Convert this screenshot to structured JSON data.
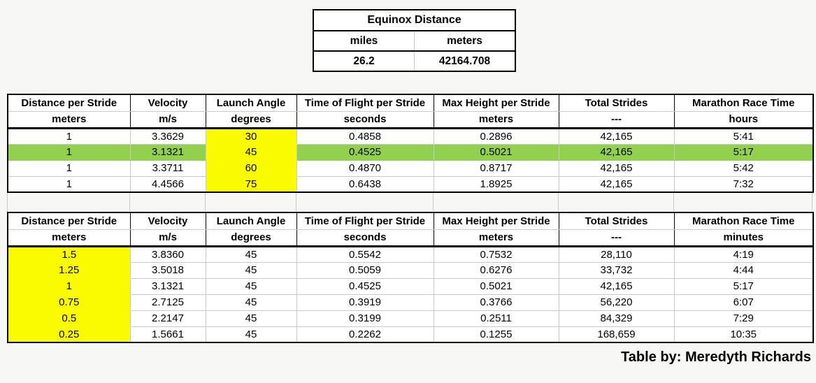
{
  "colors": {
    "page_bg": "#F7F7F6",
    "highlight_yellow": "#FBFB00",
    "highlight_green": "#92D050",
    "grid_line": "#C9C9C9",
    "border_black": "#000000"
  },
  "equinox": {
    "title": "Equinox Distance",
    "columns": [
      "miles",
      "meters"
    ],
    "values": [
      "26.2",
      "42164.708"
    ]
  },
  "table1": {
    "header_names": [
      "Distance per Stride",
      "Velocity",
      "Launch Angle",
      "Time of Flight per Stride",
      "Max Height per Stride",
      "Total Strides",
      "Marathon Race Time"
    ],
    "header_units": [
      "meters",
      "m/s",
      "degrees",
      "seconds",
      "meters",
      "---",
      "hours"
    ],
    "rows": [
      [
        "1",
        "3.3629",
        "30",
        "0.4858",
        "0.2896",
        "42,165",
        "5:41"
      ],
      [
        "1",
        "3.1321",
        "45",
        "0.4525",
        "0.5021",
        "42,165",
        "5:17"
      ],
      [
        "1",
        "3.3711",
        "60",
        "0.4870",
        "0.8717",
        "42,165",
        "5:42"
      ],
      [
        "1",
        "4.4566",
        "75",
        "0.6438",
        "1.8925",
        "42,165",
        "7:32"
      ]
    ]
  },
  "table2": {
    "header_names": [
      "Distance per Stride",
      "Velocity",
      "Launch Angle",
      "Time of Flight per Stride",
      "Max Height per Stride",
      "Total Strides",
      "Marathon Race Time"
    ],
    "header_units": [
      "meters",
      "m/s",
      "degrees",
      "seconds",
      "meters",
      "---",
      "minutes"
    ],
    "rows": [
      [
        "1.5",
        "3.8360",
        "45",
        "0.5542",
        "0.7532",
        "28,110",
        "4:19"
      ],
      [
        "1.25",
        "3.5018",
        "45",
        "0.5059",
        "0.6276",
        "33,732",
        "4:44"
      ],
      [
        "1",
        "3.1321",
        "45",
        "0.4525",
        "0.5021",
        "42,165",
        "5:17"
      ],
      [
        "0.75",
        "2.7125",
        "45",
        "0.3919",
        "0.3766",
        "56,220",
        "6:07"
      ],
      [
        "0.5",
        "2.2147",
        "45",
        "0.3199",
        "0.2511",
        "84,329",
        "7:29"
      ],
      [
        "0.25",
        "1.5661",
        "45",
        "0.2262",
        "0.1255",
        "168,659",
        "10:35"
      ]
    ]
  },
  "footer": {
    "credit": "Table by: Meredyth Richards"
  }
}
